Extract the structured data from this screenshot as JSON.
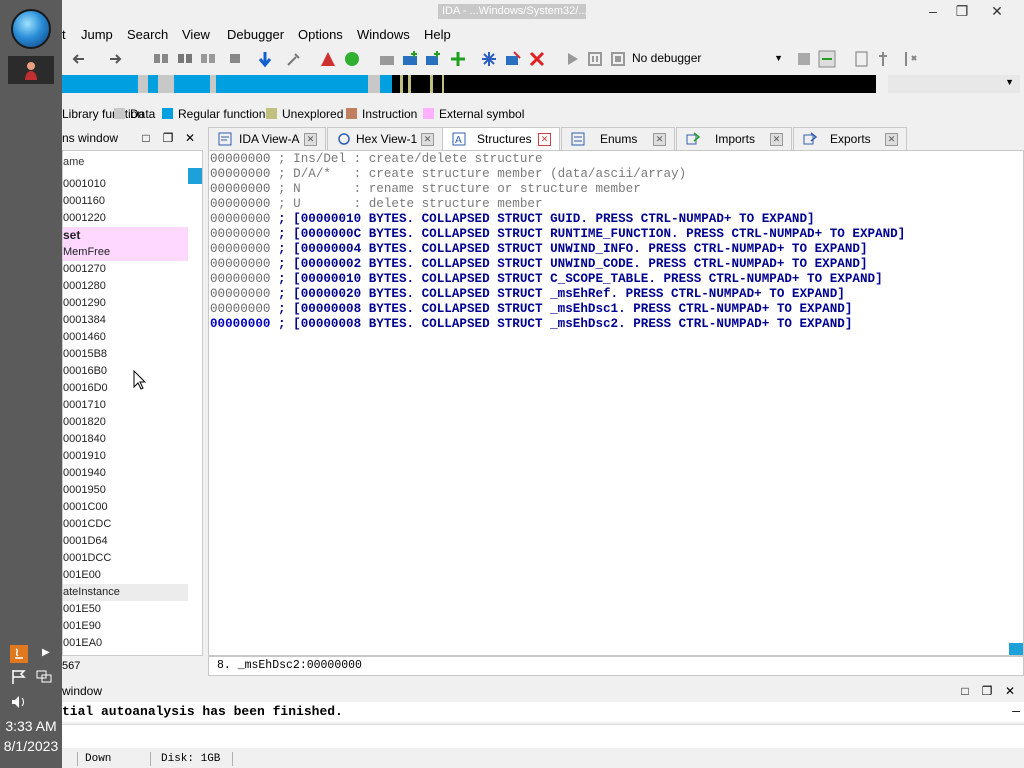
{
  "window": {
    "title": "IDA - ...Windows/System32/..."
  },
  "menu": [
    "t",
    "Jump",
    "Search",
    "View",
    "Debugger",
    "Options",
    "Windows",
    "Help"
  ],
  "toolbar": {
    "debugger_select": "No debugger"
  },
  "legend": [
    {
      "label": "Library function",
      "color": "#80d0ff"
    },
    {
      "label": "Data",
      "color": "#c8c8c8"
    },
    {
      "label": "Regular function",
      "color": "#00a0e0"
    },
    {
      "label": "Unexplored",
      "color": "#c0c080"
    },
    {
      "label": "Instruction",
      "color": "#c08060"
    },
    {
      "label": "External symbol",
      "color": "#ffb0ff"
    }
  ],
  "functions_window": {
    "title": "ns window",
    "column_header": "ame",
    "rows": [
      {
        "label": "0001010",
        "style": "normal"
      },
      {
        "label": "0001160",
        "style": "normal"
      },
      {
        "label": "0001220",
        "style": "normal"
      },
      {
        "label": "set",
        "style": "pink-bold"
      },
      {
        "label": "MemFree",
        "style": "pink"
      },
      {
        "label": "0001270",
        "style": "normal"
      },
      {
        "label": "0001280",
        "style": "normal"
      },
      {
        "label": "0001290",
        "style": "normal"
      },
      {
        "label": "0001384",
        "style": "normal"
      },
      {
        "label": "0001460",
        "style": "normal"
      },
      {
        "label": "00015B8",
        "style": "normal"
      },
      {
        "label": "00016B0",
        "style": "normal"
      },
      {
        "label": "00016D0",
        "style": "normal"
      },
      {
        "label": "0001710",
        "style": "normal"
      },
      {
        "label": "0001820",
        "style": "normal"
      },
      {
        "label": "0001840",
        "style": "normal"
      },
      {
        "label": "0001910",
        "style": "normal"
      },
      {
        "label": "0001940",
        "style": "normal"
      },
      {
        "label": "0001950",
        "style": "normal"
      },
      {
        "label": "0001C00",
        "style": "normal"
      },
      {
        "label": "0001CDC",
        "style": "normal"
      },
      {
        "label": "0001D64",
        "style": "normal"
      },
      {
        "label": "0001DCC",
        "style": "normal"
      },
      {
        "label": "001E00",
        "style": "normal"
      },
      {
        "label": "ateInstance",
        "style": "grey"
      },
      {
        "label": "001E50",
        "style": "normal"
      },
      {
        "label": "001E90",
        "style": "normal"
      },
      {
        "label": "001EA0",
        "style": "normal"
      }
    ],
    "count": "567"
  },
  "tabs": [
    {
      "label": "IDA View-A",
      "icon": "ida-view-icon",
      "active": false
    },
    {
      "label": "Hex View-1",
      "icon": "hex-view-icon",
      "active": false
    },
    {
      "label": "Structures",
      "icon": "structures-icon",
      "active": true
    },
    {
      "label": "Enums",
      "icon": "enums-icon",
      "active": false
    },
    {
      "label": "Imports",
      "icon": "imports-icon",
      "active": false
    },
    {
      "label": "Exports",
      "icon": "exports-icon",
      "active": false
    }
  ],
  "structures": {
    "lines": [
      {
        "addr": "00000000",
        "text": " ; Ins/Del : create/delete structure",
        "kind": "comment"
      },
      {
        "addr": "00000000",
        "text": " ; D/A/*   : create structure member (data/ascii/array)",
        "kind": "comment"
      },
      {
        "addr": "00000000",
        "text": " ; N       : rename structure or structure member",
        "kind": "comment"
      },
      {
        "addr": "00000000",
        "text": " ; U       : delete structure member",
        "kind": "comment"
      },
      {
        "addr": "00000000",
        "text": " ; [00000010 BYTES. COLLAPSED STRUCT GUID. PRESS CTRL-NUMPAD+ TO EXPAND]",
        "kind": "collapsed"
      },
      {
        "addr": "00000000",
        "text": " ; [0000000C BYTES. COLLAPSED STRUCT RUNTIME_FUNCTION. PRESS CTRL-NUMPAD+ TO EXPAND]",
        "kind": "collapsed"
      },
      {
        "addr": "00000000",
        "text": " ; [00000004 BYTES. COLLAPSED STRUCT UNWIND_INFO. PRESS CTRL-NUMPAD+ TO EXPAND]",
        "kind": "collapsed"
      },
      {
        "addr": "00000000",
        "text": " ; [00000002 BYTES. COLLAPSED STRUCT UNWIND_CODE. PRESS CTRL-NUMPAD+ TO EXPAND]",
        "kind": "collapsed"
      },
      {
        "addr": "00000000",
        "text": " ; [00000010 BYTES. COLLAPSED STRUCT C_SCOPE_TABLE. PRESS CTRL-NUMPAD+ TO EXPAND]",
        "kind": "collapsed"
      },
      {
        "addr": "00000000",
        "text": " ; [00000020 BYTES. COLLAPSED STRUCT _msEhRef. PRESS CTRL-NUMPAD+ TO EXPAND]",
        "kind": "collapsed"
      },
      {
        "addr": "00000000",
        "text": " ; [00000008 BYTES. COLLAPSED STRUCT _msEhDsc1. PRESS CTRL-NUMPAD+ TO EXPAND]",
        "kind": "collapsed"
      },
      {
        "addr": "00000000",
        "text": " ; [00000008 BYTES. COLLAPSED STRUCT _msEhDsc2. PRESS CTRL-NUMPAD+ TO EXPAND]",
        "kind": "last"
      }
    ],
    "status": "8. _msEhDsc2:00000000"
  },
  "output_window": {
    "title": "window",
    "message": "tial autoanalysis has been finished."
  },
  "statusbar": {
    "state": "Down",
    "disk": "Disk: 1GB"
  },
  "taskbar": {
    "time": "3:33 AM",
    "date": "8/1/2023"
  }
}
